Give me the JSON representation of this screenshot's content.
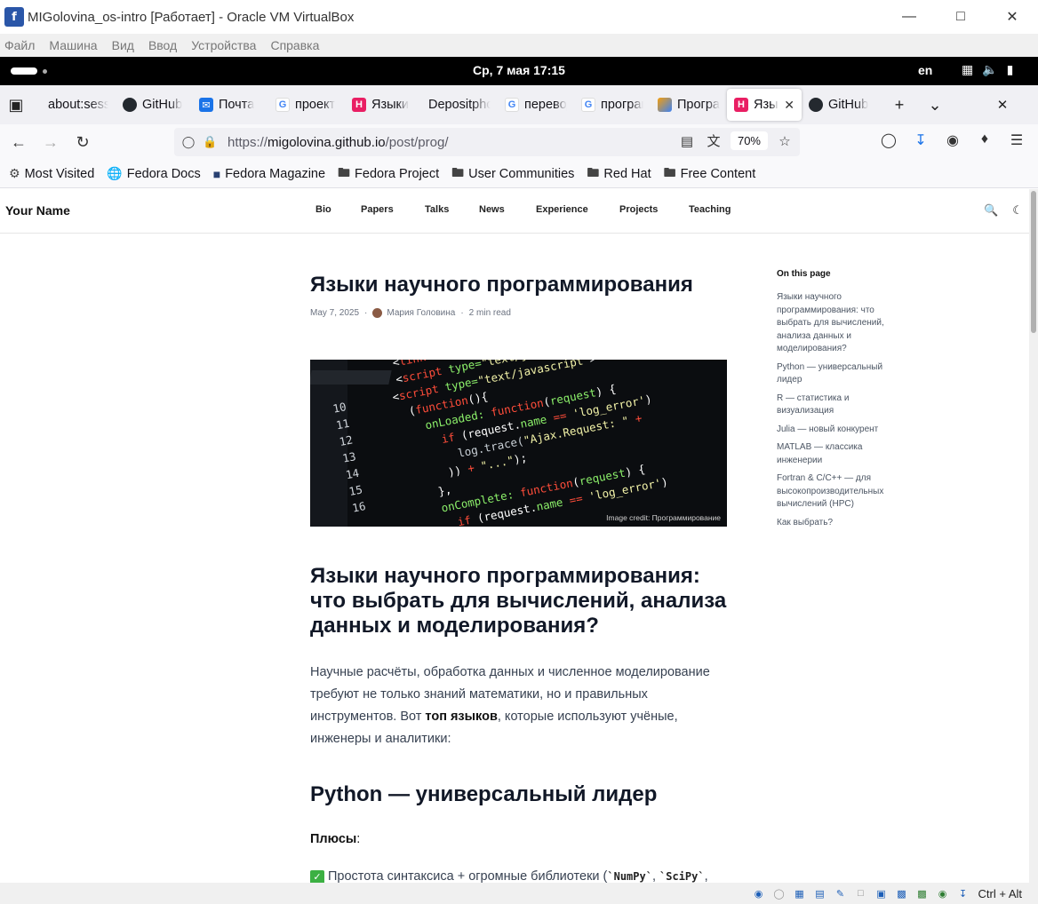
{
  "vbox": {
    "window_title": "MIGolovina_os-intro [Работает] - Oracle VM VirtualBox",
    "menu": [
      "Файл",
      "Машина",
      "Вид",
      "Ввод",
      "Устройства",
      "Справка"
    ],
    "host_key": "Ctrl + Alt"
  },
  "gnome": {
    "clock": "Ср, 7 мая  17:15",
    "language": "en"
  },
  "tabs": [
    {
      "title": "about:sessionrestore",
      "favicon": "none",
      "color": "#f0f0f4"
    },
    {
      "title": "GitHub",
      "favicon": "github-icon",
      "color": "#24292f"
    },
    {
      "title": "Почта",
      "favicon": "mail-icon",
      "color": "#1a73e8"
    },
    {
      "title": "проект",
      "favicon": "google-icon",
      "color": "#4285f4"
    },
    {
      "title": "Языки",
      "favicon": "hugo-icon",
      "color": "#e91e63"
    },
    {
      "title": "Depositphotos",
      "favicon": "none",
      "color": "#f0f0f4"
    },
    {
      "title": "перевод",
      "favicon": "google-icon",
      "color": "#4285f4"
    },
    {
      "title": "программирование",
      "favicon": "google-icon",
      "color": "#4285f4"
    },
    {
      "title": "Программирование",
      "favicon": "colorful-icon",
      "color": "#f59e0b"
    },
    {
      "title": "Языки",
      "favicon": "hugo-icon",
      "color": "#e91e63",
      "active": true
    },
    {
      "title": "GitHub",
      "favicon": "github-icon",
      "color": "#24292f"
    }
  ],
  "urlbar": {
    "url_prefix": "https://",
    "url_host": "migolovina.github.io",
    "url_path": "/post/prog/",
    "zoom": "70%"
  },
  "bookmarks": [
    {
      "label": "Most Visited",
      "icon": "gear-icon"
    },
    {
      "label": "Fedora Docs",
      "icon": "globe-icon"
    },
    {
      "label": "Fedora Magazine",
      "icon": "fm-icon"
    },
    {
      "label": "Fedora Project",
      "icon": "folder-icon"
    },
    {
      "label": "User Communities",
      "icon": "folder-icon"
    },
    {
      "label": "Red Hat",
      "icon": "folder-icon"
    },
    {
      "label": "Free Content",
      "icon": "folder-icon"
    }
  ],
  "site": {
    "name": "Your Name",
    "nav": [
      "Bio",
      "Papers",
      "Talks",
      "News",
      "Experience",
      "Projects",
      "Teaching"
    ]
  },
  "article": {
    "title": "Языки научного программирования",
    "date": "May 7, 2025",
    "author": "Мария Головина",
    "read_time": "2 min read",
    "image_credit": "Image credit: Программирование",
    "h1": "Языки научного программирования: что выбрать для вычислений, анализа данных и моделирования?",
    "para_before": "Научные расчёты, обработка данных и численное моделирование требуют не только знаний математики, но и правильных инструментов. Вот ",
    "para_bold": "топ языков",
    "para_after": ", которые используют учёные, инженеры и аналитики:",
    "h2": "Python — универсальный лидер",
    "pros_label": "Плюсы",
    "pros_colon": ":",
    "item1_text": "Простота синтаксиса + огромные библиотеки (",
    "item1_code1": "`NumPy`",
    "item1_sep": ", ",
    "item1_code2": "`SciPy`",
    "item1_tail": ","
  },
  "toc": {
    "title": "On this page",
    "items": [
      "Языки научного программирования: что выбрать для вычислений, анализа данных и моделирования?",
      "Python — универсальный лидер",
      "R — статистика и визуализация",
      "Julia — новый конкурент",
      "MATLAB — классика инженерии",
      "Fortran & C/C++ — для высокопроизводительных вычислений (HPC)",
      "Как выбрать?"
    ]
  }
}
